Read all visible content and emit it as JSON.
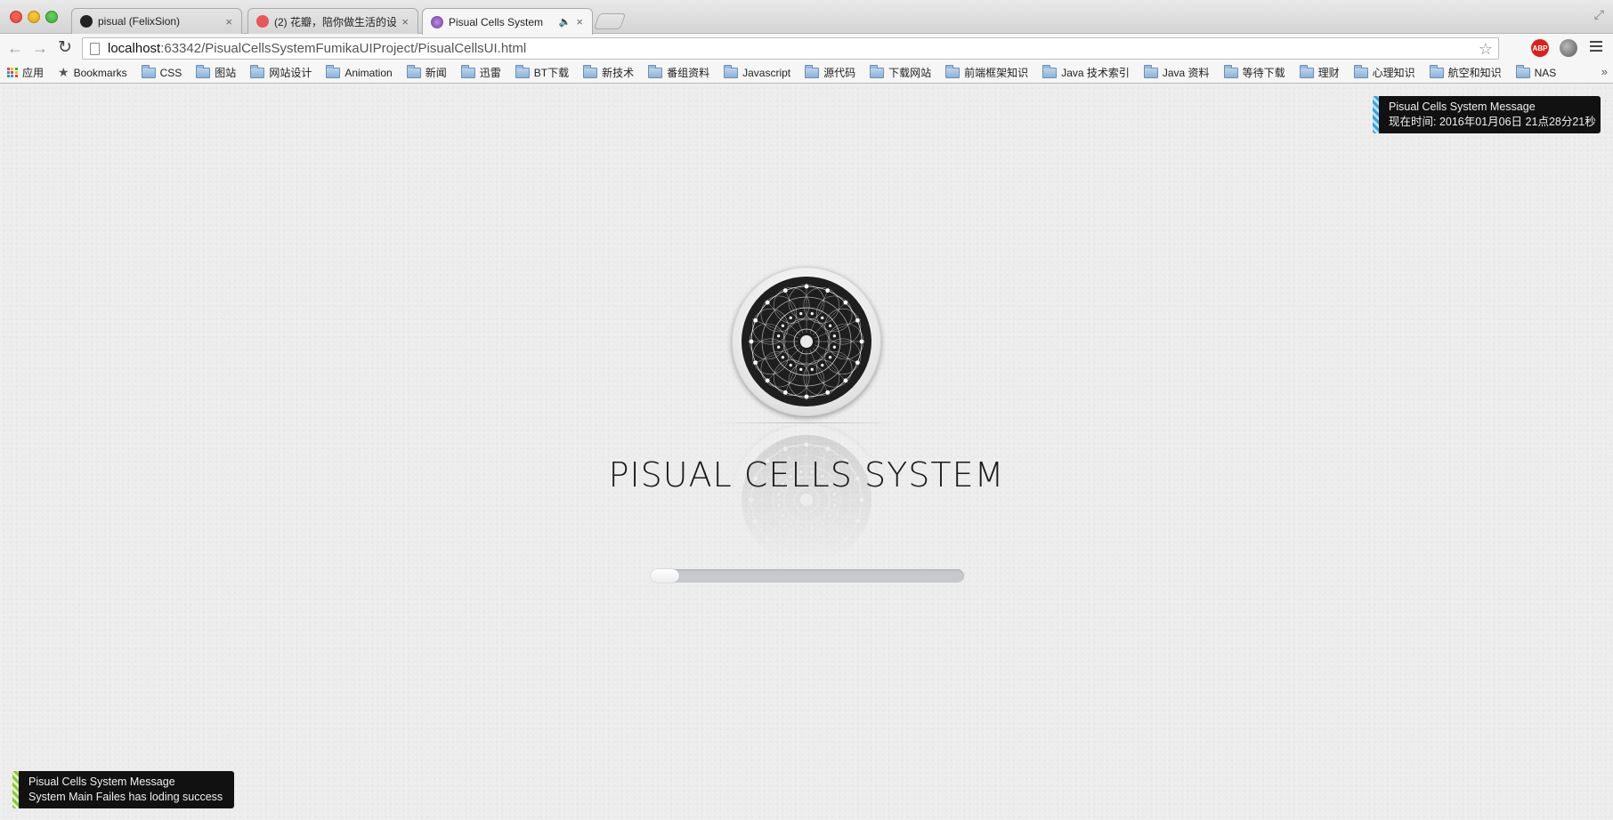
{
  "browser": {
    "tabs": [
      {
        "title": "pisual (FelixSion)",
        "close": "×"
      },
      {
        "title": "(2) 花瓣，陪你做生活的设计",
        "close": "×"
      },
      {
        "title": "Pisual Cells System",
        "close": "×",
        "sound": "🔈"
      }
    ],
    "url_host": "localhost",
    "url_path": ":63342/PisualCellsSystemFumikaUIProject/PisualCellsUI.html",
    "extensions": {
      "adblock_label": "ABP"
    }
  },
  "bookmarks": {
    "apps_label": "应用",
    "bookmarks_label": "Bookmarks",
    "folders": [
      "CSS",
      "图站",
      "网站设计",
      "Animation",
      "新闻",
      "迅雷",
      "BT下载",
      "新技术",
      "番组资料",
      "Javascript",
      "源代码",
      "下载网站",
      "前端框架知识",
      "Java 技术索引",
      "Java 资料",
      "等待下载",
      "理财",
      "心理知识",
      "航空和知识",
      "NAS"
    ],
    "overflow": "»"
  },
  "page": {
    "title": "PISUAL CELLS SYSTEM",
    "progress_fraction": 0.09,
    "colors": {
      "progress_track": "#c7cacd",
      "toast_bg": "#111111",
      "info_stripe": "#3da0e0",
      "success_stripe": "#8cc63f"
    },
    "toast_top": {
      "title": "Pisual Cells System Message",
      "body": "现在时间: 2016年01月06日 21点28分21秒"
    },
    "toast_bottom": {
      "title": "Pisual Cells System Message",
      "body": "System Main Failes has loding success"
    }
  }
}
